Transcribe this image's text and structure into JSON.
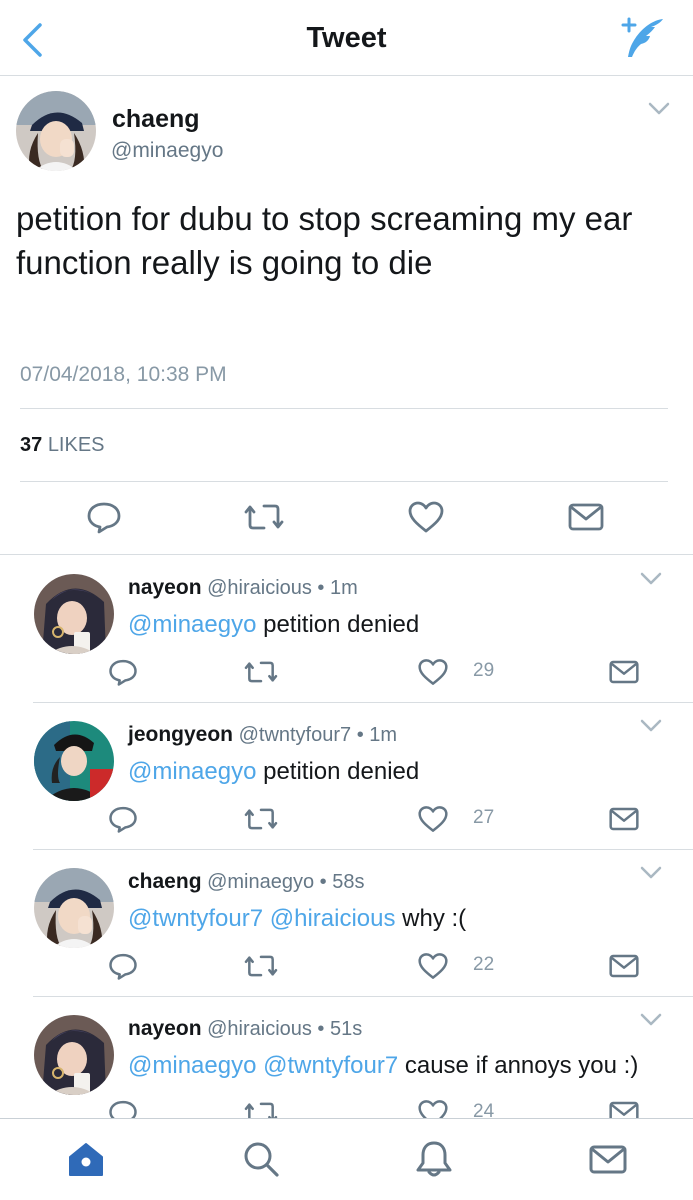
{
  "nav": {
    "title": "Tweet"
  },
  "tweet": {
    "name": "chaeng",
    "handle": "@minaegyo",
    "text": "petition for dubu to stop screaming my ear function really is going to die",
    "timestamp": "07/04/2018, 10:38 PM",
    "likes_count": "37",
    "likes_label": "LIKES"
  },
  "replies": [
    {
      "name": "nayeon",
      "meta": "@hiraicious • 1m",
      "mentions": "@minaegyo",
      "text": " petition denied",
      "likes": "29"
    },
    {
      "name": "jeongyeon",
      "meta": "@twntyfour7 • 1m",
      "mentions": "@minaegyo",
      "text": " petition denied",
      "likes": "27"
    },
    {
      "name": "chaeng",
      "meta": "@minaegyo • 58s",
      "mentions": "@twntyfour7 @hiraicious",
      "text": " why :(",
      "likes": "22"
    },
    {
      "name": "nayeon",
      "meta": "@hiraicious • 51s",
      "mentions": "@minaegyo @twntyfour7",
      "text": " cause if annoys you :)",
      "likes": "24"
    }
  ],
  "icons": {
    "nav": [
      "back-icon",
      "compose-tweet-icon"
    ],
    "actions": [
      "reply-icon",
      "retweet-icon",
      "like-icon",
      "message-icon"
    ],
    "tabs": [
      "home-icon",
      "search-icon",
      "notifications-icon",
      "messages-icon"
    ]
  },
  "colors": {
    "accent": "#1da1f2",
    "mention": "#4ea6e8",
    "tab_active": "#2f6ab8",
    "icon_gray": "#657786"
  }
}
